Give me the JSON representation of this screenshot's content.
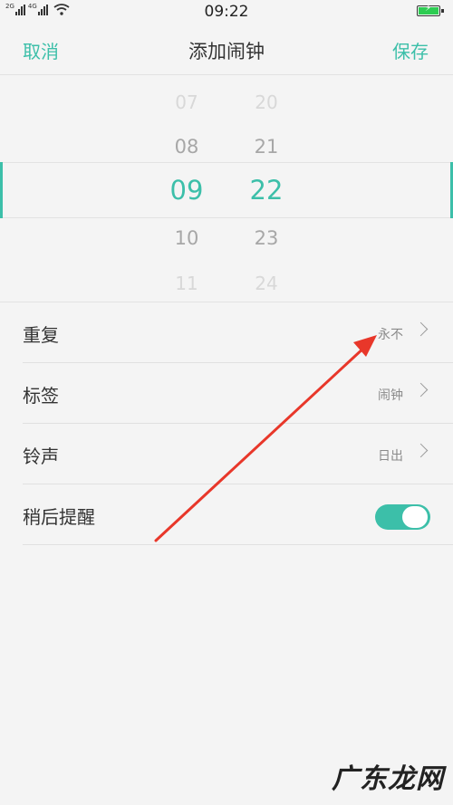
{
  "status_bar": {
    "net1": "2G",
    "net2": "4G",
    "time": "09:22",
    "battery_state": "charging"
  },
  "nav": {
    "cancel": "取消",
    "title": "添加闹钟",
    "save": "保存"
  },
  "picker": {
    "hours": [
      "07",
      "08",
      "09",
      "10",
      "11"
    ],
    "minutes": [
      "20",
      "21",
      "22",
      "23",
      "24"
    ],
    "selected_hour": "09",
    "selected_minute": "22"
  },
  "settings": [
    {
      "label": "重复",
      "value": "永不"
    },
    {
      "label": "标签",
      "value": "闹钟"
    },
    {
      "label": "铃声",
      "value": "日出"
    },
    {
      "label": "稍后提醒",
      "toggle_on": true
    }
  ],
  "colors": {
    "accent": "#3cbfa9",
    "annotation_arrow": "#e8372a"
  },
  "watermark": "广东龙网"
}
